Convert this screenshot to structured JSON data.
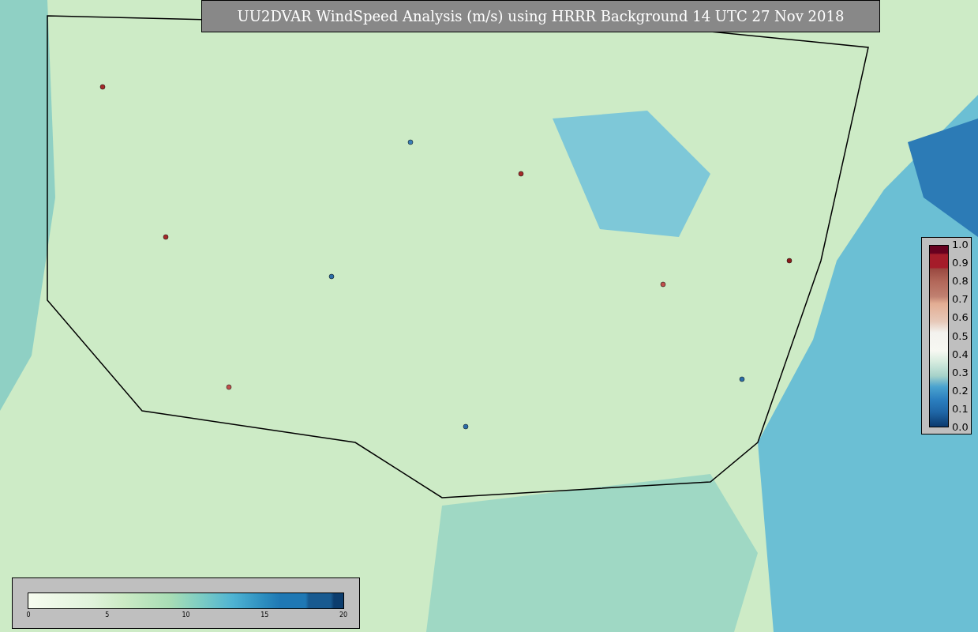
{
  "title": "UU2DVAR WindSpeed Analysis (m/s) using HRRR Background 14 UTC 27 Nov 2018",
  "observation_colorbar": {
    "ticks": [
      "1.0",
      "0.9",
      "0.8",
      "0.7",
      "0.6",
      "0.5",
      "0.4",
      "0.3",
      "0.2",
      "0.1",
      "0.0"
    ]
  },
  "windspeed_colorbar": {
    "ticks": [
      "0",
      "5",
      "10",
      "15",
      "20"
    ]
  }
}
